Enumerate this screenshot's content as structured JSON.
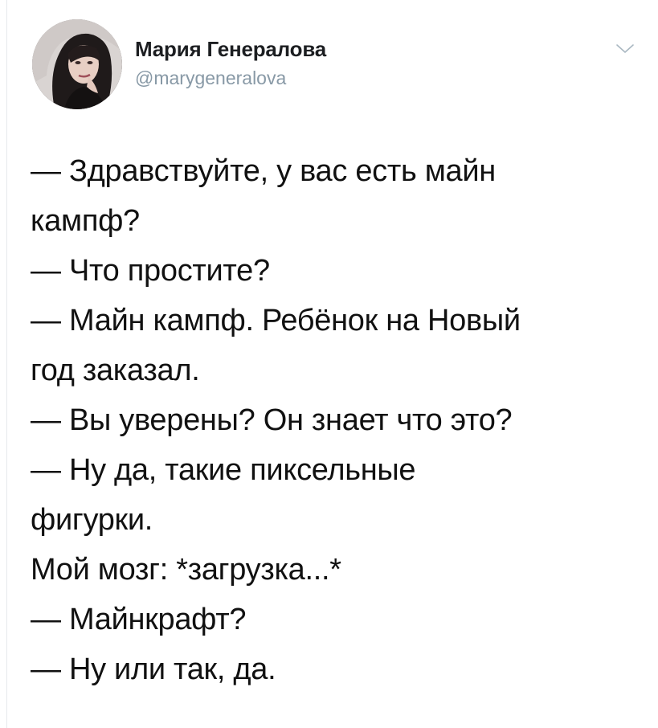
{
  "author": {
    "display_name": "Мария Генералова",
    "handle": "@marygeneralova",
    "avatar": "profile-photo"
  },
  "menu_icon": "chevron-down-icon",
  "tweet": {
    "lines": [
      "— Здравствуйте, у вас есть майн",
      "кампф?",
      "— Что простите?",
      "— Майн кампф. Ребёнок на Новый",
      "год заказал.",
      "— Вы уверены? Он знает что это?",
      "— Ну да, такие пиксельные",
      "фигурки.",
      "Мой мозг: *загрузка...*",
      "— Майнкрафт?",
      "— Ну или так, да."
    ]
  },
  "colors": {
    "text": "#111111",
    "handle": "#8899a6",
    "divider": "#e6e9ec"
  }
}
